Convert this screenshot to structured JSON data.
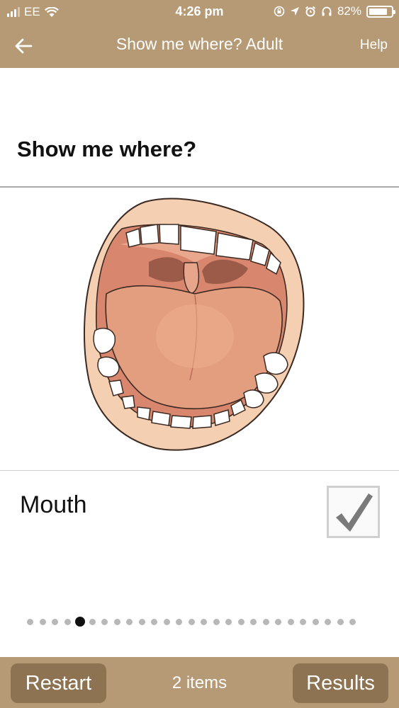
{
  "status_bar": {
    "carrier": "EE",
    "time": "4:26 pm",
    "battery": "82%",
    "battery_level": 0.82,
    "icons": [
      "signal-icon",
      "wifi-icon",
      "rotation-lock-icon",
      "location-icon",
      "alarm-icon",
      "headphones-icon",
      "battery-icon"
    ]
  },
  "nav": {
    "title": "Show me where? Adult",
    "help": "Help",
    "back_icon": "back-arrow-icon"
  },
  "main": {
    "heading": "Show me where?",
    "illustration": "open-mouth-illustration",
    "item_label": "Mouth",
    "item_checked": true
  },
  "pager": {
    "total": 27,
    "current": 5
  },
  "toolbar": {
    "restart": "Restart",
    "count": "2 items",
    "results": "Results"
  },
  "colors": {
    "brand": "#b59a75",
    "button": "#8d7351"
  }
}
